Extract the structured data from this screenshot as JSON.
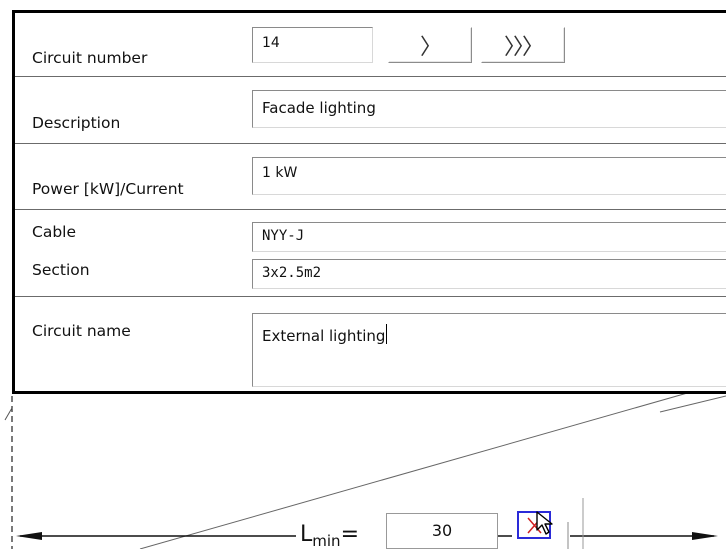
{
  "form": {
    "circuit_number": {
      "label": "Circuit number",
      "value": "14"
    },
    "nav": {
      "next_label": "〉",
      "last_label": "〉〉〉"
    },
    "description": {
      "label": "Description",
      "value": "Facade lighting"
    },
    "power": {
      "label": "Power [kW]/Current",
      "value": "1 kW"
    },
    "cable": {
      "label": "Cable",
      "value": "NYY-J"
    },
    "section": {
      "label": "Section",
      "value": "3x2.5m2"
    },
    "circuit_name": {
      "label": "Circuit name",
      "value": "External lighting"
    }
  },
  "dimension": {
    "label": "L",
    "label_sub": "min",
    "equals": "=",
    "value": "30"
  },
  "colors": {
    "dialog_border": "#000000",
    "pick_button_border": "#2a2ad8",
    "pick_cross": "#d02020"
  },
  "icons": [
    "next-icon",
    "last-icon",
    "pick-point-icon",
    "cursor-icon"
  ]
}
